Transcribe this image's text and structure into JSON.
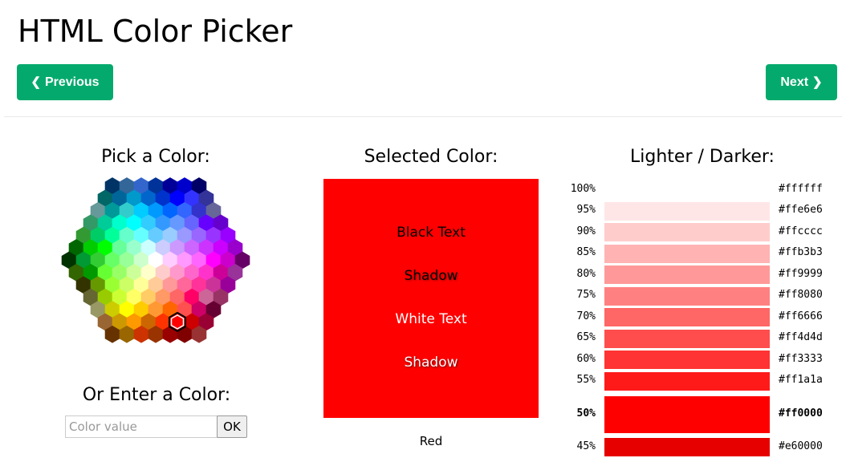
{
  "page": {
    "title": "HTML Color Picker",
    "prev_label": "Previous",
    "next_label": "Next"
  },
  "picker": {
    "title": "Pick a Color:",
    "selected": "#ff0000",
    "rows": [
      [
        "#003366",
        "#336699",
        "#3366CC",
        "#003399",
        "#000099",
        "#0000CC",
        "#000066"
      ],
      [
        "#006666",
        "#006699",
        "#0099CC",
        "#0066CC",
        "#0033CC",
        "#0000FF",
        "#3333FF",
        "#333399"
      ],
      [
        "#669999",
        "#009999",
        "#33CCCC",
        "#00CCFF",
        "#0099FF",
        "#0066FF",
        "#3366FF",
        "#3333CC",
        "#666699"
      ],
      [
        "#339966",
        "#00CC99",
        "#00FFCC",
        "#00FFFF",
        "#33CCFF",
        "#3399FF",
        "#6699FF",
        "#6666FF",
        "#6600FF",
        "#6600CC"
      ],
      [
        "#339933",
        "#00CC66",
        "#00FF99",
        "#66FFCC",
        "#66FFFF",
        "#66CCFF",
        "#99CCFF",
        "#9999FF",
        "#9966FF",
        "#9933FF",
        "#9900FF"
      ],
      [
        "#006600",
        "#00CC00",
        "#00FF00",
        "#66FF99",
        "#99FFCC",
        "#CCFFFF",
        "#CCCCFF",
        "#CC99FF",
        "#CC66FF",
        "#CC33FF",
        "#CC00FF",
        "#9900CC"
      ],
      [
        "#003300",
        "#009933",
        "#33CC33",
        "#66FF66",
        "#99FF99",
        "#CCFFCC",
        "#FFFFFF",
        "#FFCCFF",
        "#FF99FF",
        "#FF66FF",
        "#FF00FF",
        "#CC00CC",
        "#660066"
      ],
      [
        "#336600",
        "#009900",
        "#66FF33",
        "#99FF66",
        "#CCFF99",
        "#FFFFCC",
        "#FFCCCC",
        "#FF99CC",
        "#FF66CC",
        "#FF33CC",
        "#CC0099",
        "#993399"
      ],
      [
        "#333300",
        "#669900",
        "#99FF33",
        "#CCFF66",
        "#FFFF99",
        "#FFCC99",
        "#FF9999",
        "#FF6699",
        "#FF3399",
        "#CC3399",
        "#990099"
      ],
      [
        "#666633",
        "#99CC00",
        "#CCFF33",
        "#FFFF66",
        "#FFCC66",
        "#FF9966",
        "#FF6666",
        "#FF0066",
        "#CC6699",
        "#993366"
      ],
      [
        "#999966",
        "#CCCC00",
        "#FFFF00",
        "#FFCC00",
        "#FF9933",
        "#FF6600",
        "#FF5050",
        "#CC0066",
        "#660033"
      ],
      [
        "#996633",
        "#CC9900",
        "#FF9900",
        "#CC6600",
        "#FF3300",
        "#FF0000",
        "#CC0000",
        "#990033"
      ],
      [
        "#663300",
        "#996600",
        "#CC3300",
        "#993300",
        "#990000",
        "#800000",
        "#993333"
      ]
    ]
  },
  "enter": {
    "title": "Or Enter a Color:",
    "placeholder": "Color value",
    "ok_label": "OK"
  },
  "selected": {
    "title": "Selected Color:",
    "color": "#ff0000",
    "black_text": "Black Text",
    "shadow": "Shadow",
    "white_text": "White Text",
    "name": "Red"
  },
  "shades": {
    "title": "Lighter / Darker:",
    "rows": [
      {
        "pct": "100%",
        "hex": "#ffffff"
      },
      {
        "pct": "95%",
        "hex": "#ffe6e6"
      },
      {
        "pct": "90%",
        "hex": "#ffcccc"
      },
      {
        "pct": "85%",
        "hex": "#ffb3b3"
      },
      {
        "pct": "80%",
        "hex": "#ff9999"
      },
      {
        "pct": "75%",
        "hex": "#ff8080"
      },
      {
        "pct": "70%",
        "hex": "#ff6666"
      },
      {
        "pct": "65%",
        "hex": "#ff4d4d"
      },
      {
        "pct": "60%",
        "hex": "#ff3333"
      },
      {
        "pct": "55%",
        "hex": "#ff1a1a"
      },
      {
        "pct": "50%",
        "hex": "#ff0000",
        "current": true
      },
      {
        "pct": "45%",
        "hex": "#e60000"
      }
    ]
  },
  "colors": {
    "brand_green": "#04aa6d"
  }
}
